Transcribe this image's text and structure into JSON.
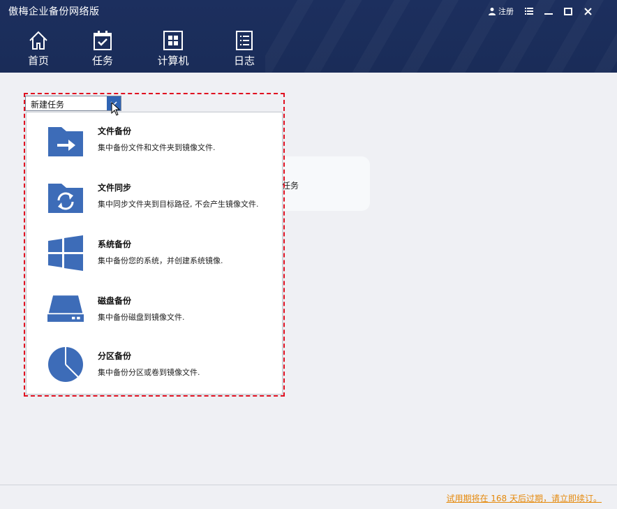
{
  "app": {
    "title": "傲梅企业备份网络版"
  },
  "window": {
    "register_label": "注册"
  },
  "nav": [
    {
      "label": "首页",
      "icon": "home-icon"
    },
    {
      "label": "任务",
      "icon": "task-icon"
    },
    {
      "label": "计算机",
      "icon": "computer-icon"
    },
    {
      "label": "日志",
      "icon": "log-icon"
    }
  ],
  "background": {
    "card_text": "任务"
  },
  "dropdown": {
    "selected": "新建任务",
    "items": [
      {
        "title": "文件备份",
        "desc": "集中备份文件和文件夹到镜像文件.",
        "icon": "file-backup-icon"
      },
      {
        "title": "文件同步",
        "desc": "集中同步文件夹到目标路径, 不会产生镜像文件.",
        "icon": "file-sync-icon"
      },
      {
        "title": "系统备份",
        "desc": "集中备份您的系统，并创建系统镜像.",
        "icon": "system-backup-icon"
      },
      {
        "title": "磁盘备份",
        "desc": "集中备份磁盘到镜像文件.",
        "icon": "disk-backup-icon"
      },
      {
        "title": "分区备份",
        "desc": "集中备份分区或卷到镜像文件.",
        "icon": "partition-backup-icon"
      }
    ]
  },
  "footer": {
    "trial_text": "试用期将在 168 天后过期，请立即续订。"
  },
  "colors": {
    "header": "#1c2f5e",
    "accent": "#3d6cb8",
    "highlight": "#e01020",
    "trial": "#e5890b"
  }
}
